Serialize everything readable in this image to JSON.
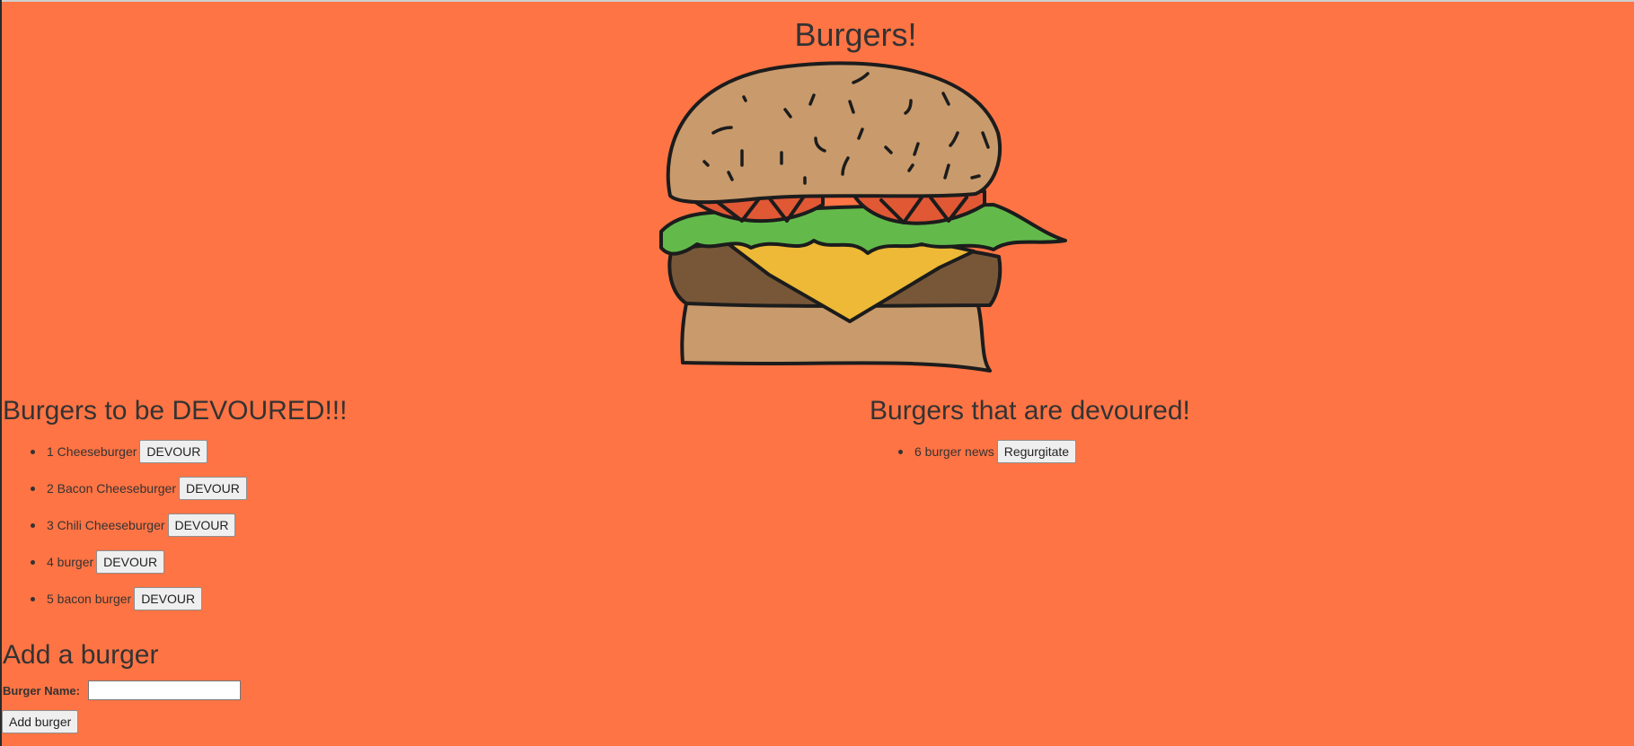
{
  "page": {
    "title": "Burgers!"
  },
  "uneaten": {
    "heading": "Burgers to be DEVOURED!!!",
    "items": [
      {
        "label": "1 Cheeseburger",
        "button": "DEVOUR"
      },
      {
        "label": "2 Bacon Cheeseburger",
        "button": "DEVOUR"
      },
      {
        "label": "3 Chili Cheeseburger",
        "button": "DEVOUR"
      },
      {
        "label": "4 burger",
        "button": "DEVOUR"
      },
      {
        "label": "5 bacon burger",
        "button": "DEVOUR"
      }
    ]
  },
  "devoured": {
    "heading": "Burgers that are devoured!",
    "items": [
      {
        "label": "6 burger news",
        "button": "Regurgitate"
      }
    ]
  },
  "form": {
    "heading": "Add a burger",
    "field_label": "Burger Name:",
    "field_value": "",
    "submit_label": "Add burger"
  },
  "colors": {
    "background": "#FF7444",
    "bun": "#C99A6B",
    "tomato": "#E15835",
    "lettuce": "#63BA4B",
    "cheese": "#EDB936",
    "patty": "#785738"
  },
  "illustration": {
    "name": "burger-illustration"
  }
}
